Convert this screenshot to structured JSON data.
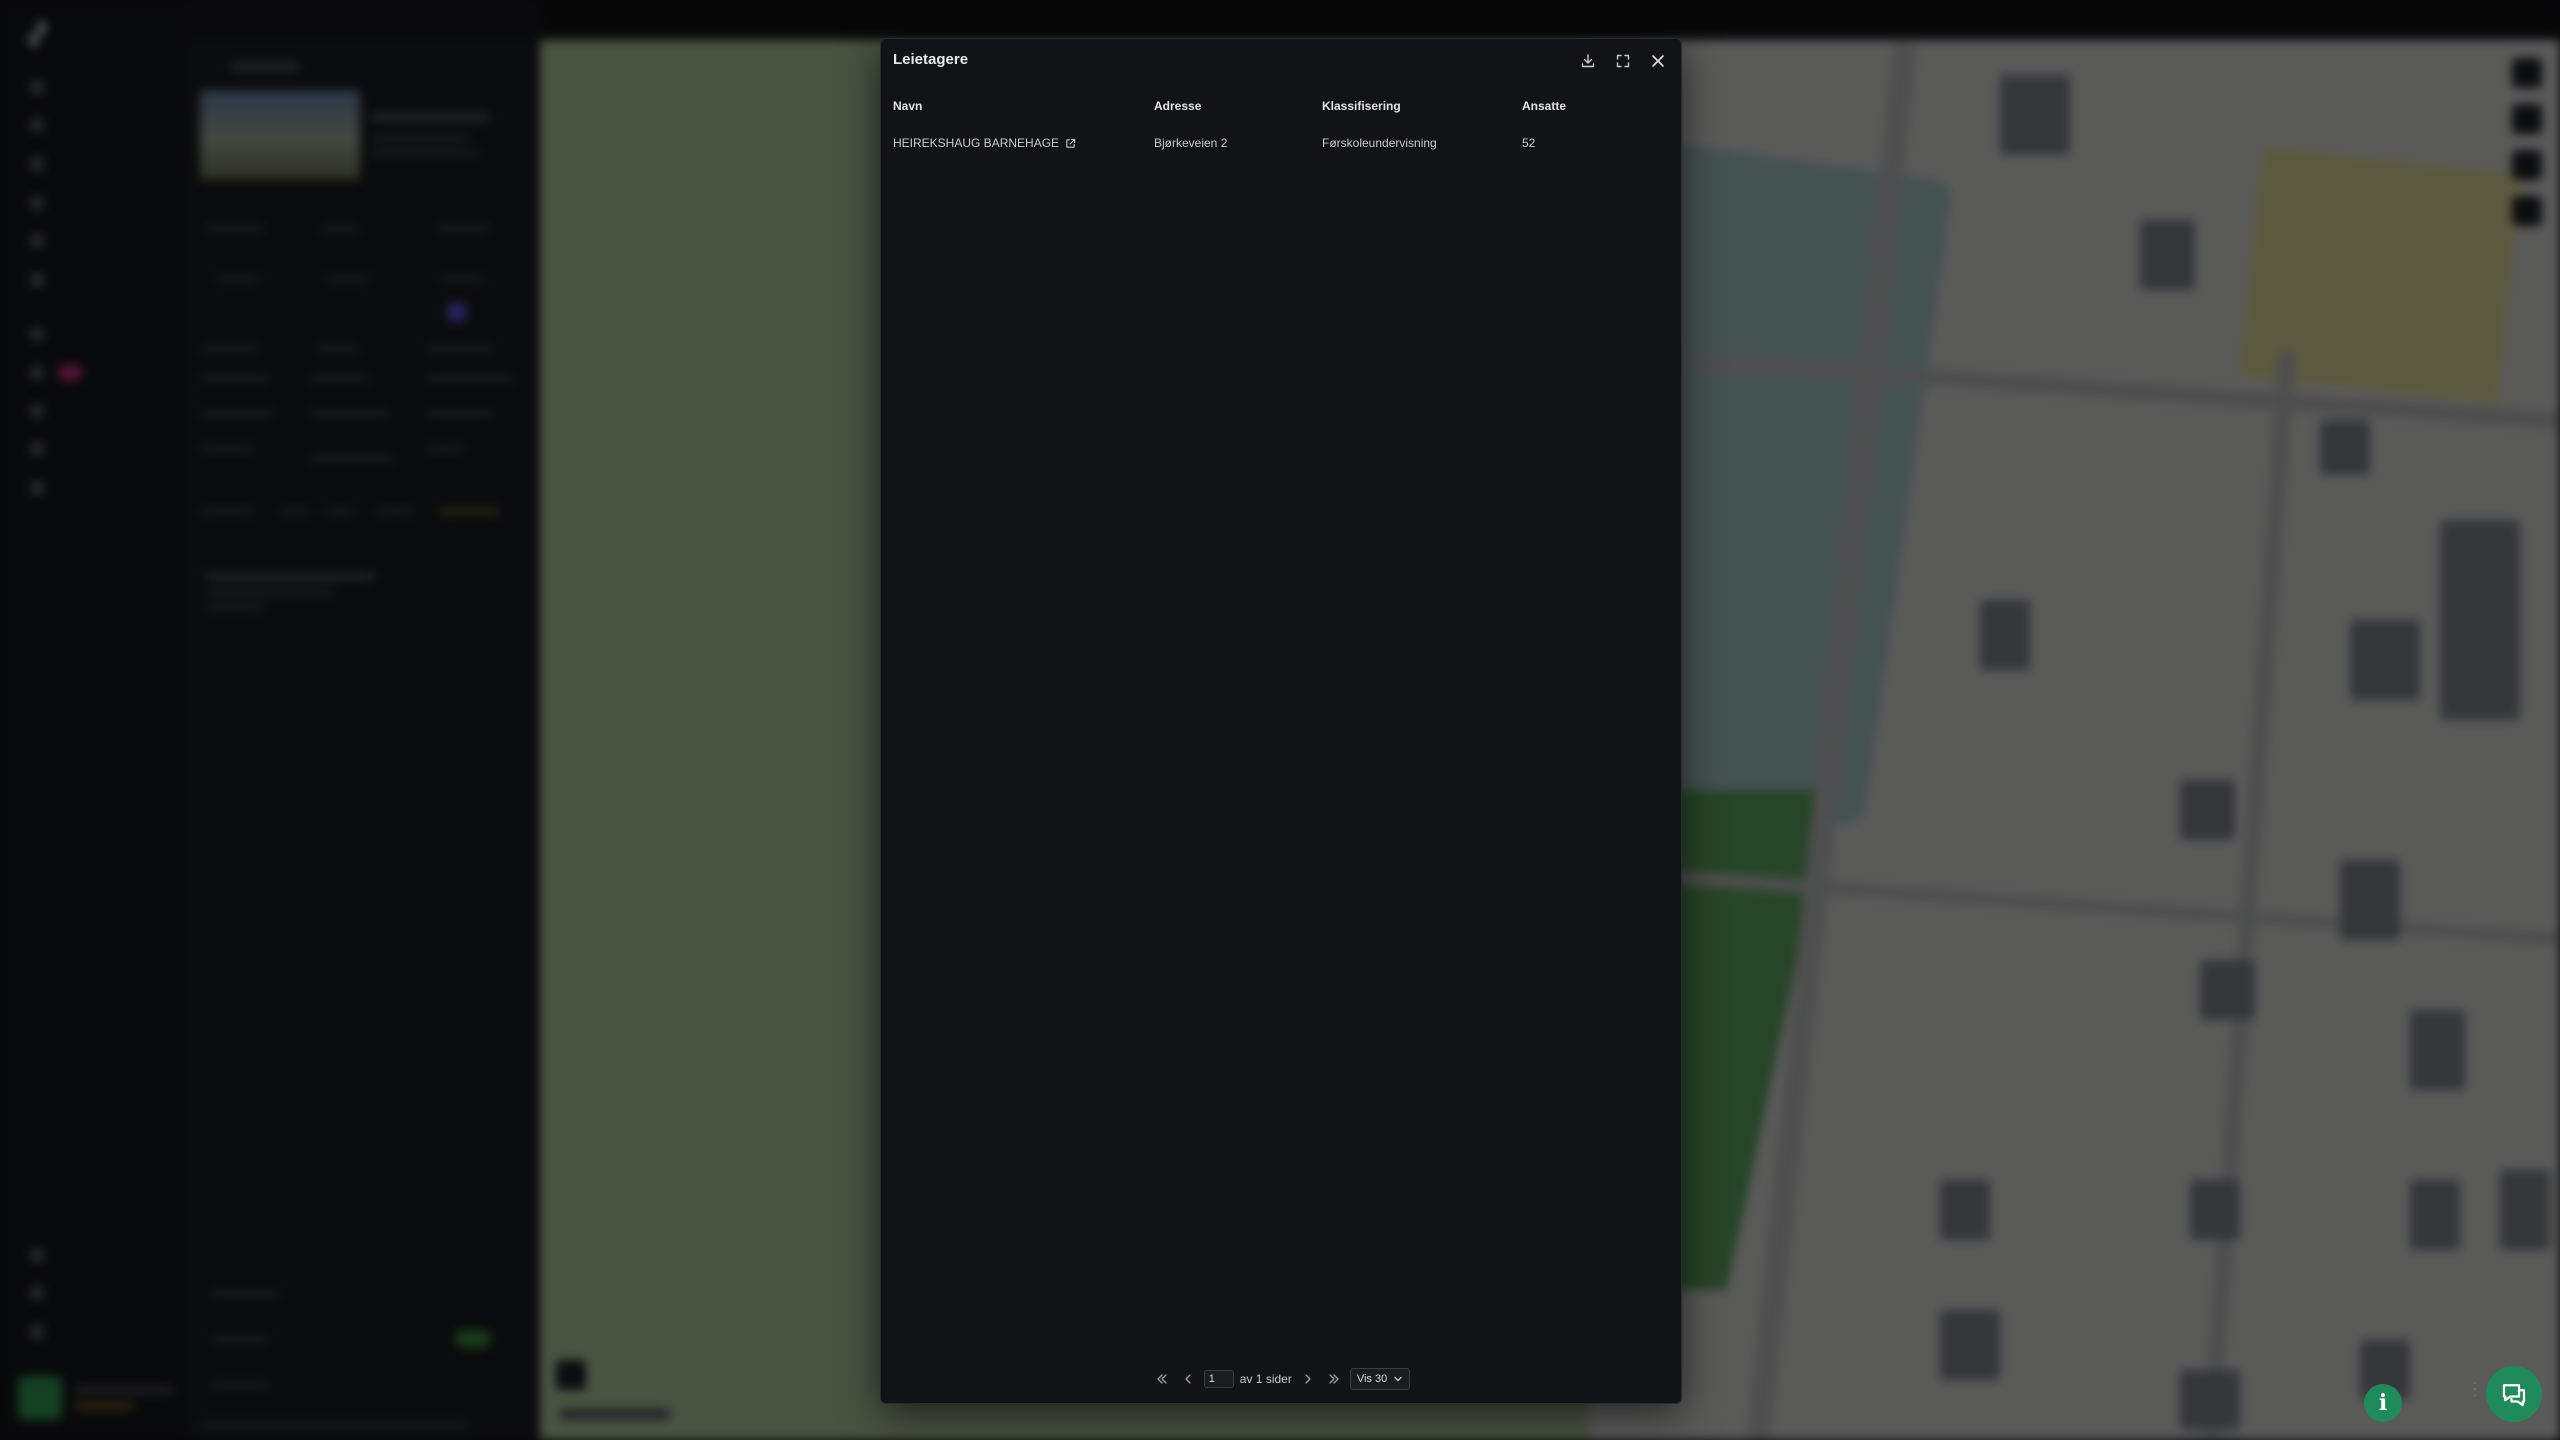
{
  "modal": {
    "title": "Leietagere",
    "actions": {
      "download": "download-icon",
      "fullscreen": "expand-icon",
      "close": "close-icon"
    }
  },
  "table": {
    "columns": [
      "Navn",
      "Adresse",
      "Klassifisering",
      "Ansatte"
    ],
    "rows": [
      {
        "navn": "HEIREKSHAUG BARNEHAGE",
        "adresse": "Bjørkeveien 2",
        "klassifisering": "Førskoleundervisning",
        "ansatte": "52"
      }
    ]
  },
  "pagination": {
    "current_page": "1",
    "of_pages_text": "av 1 sider",
    "page_size_label": "Vis 30"
  },
  "colors": {
    "modal_bg": "#121316",
    "accent_green": "#1f8a5a",
    "text_primary": "#e3e4e8"
  }
}
